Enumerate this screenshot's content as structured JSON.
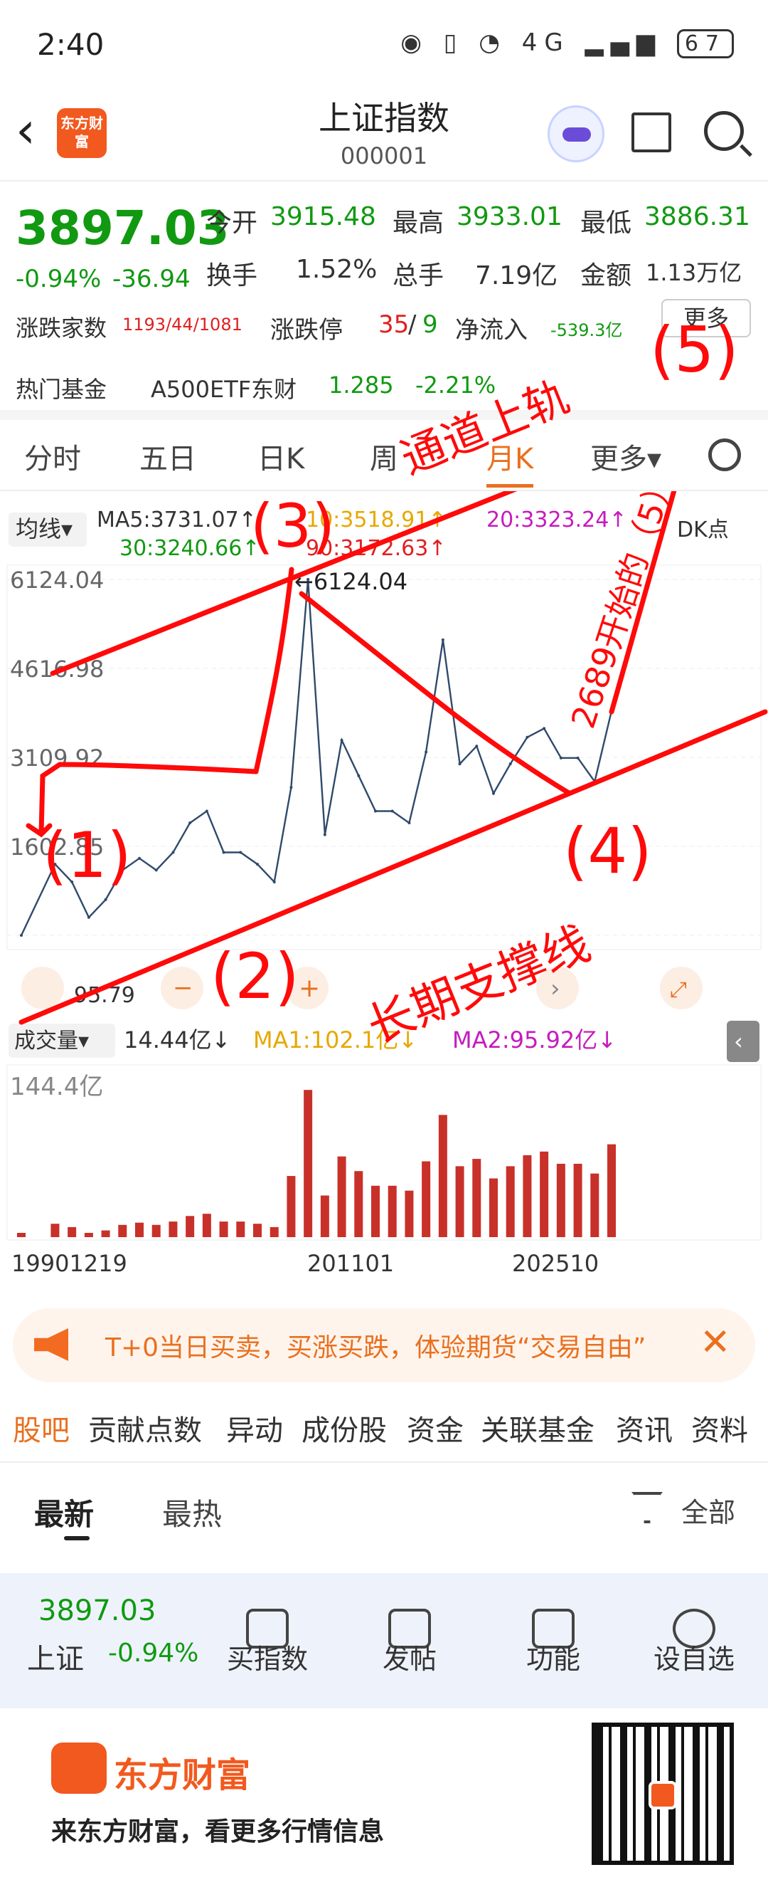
{
  "status_bar": {
    "time": "2:40",
    "network": "4G",
    "battery": "67"
  },
  "header": {
    "brand_logo_text": "东方财富",
    "title": "上证指数",
    "code": "000001"
  },
  "quote": {
    "price": "3897.03",
    "pct": "-0.94%",
    "change": "-36.94",
    "open_label": "今开",
    "open": "3915.48",
    "high_label": "最高",
    "high": "3933.01",
    "low_label": "最低",
    "low": "3886.31",
    "turnover_label": "换手",
    "turnover": "1.52%",
    "volume_label": "总手",
    "volume": "7.19亿",
    "amount_label": "金额",
    "amount": "1.13万亿",
    "breadth_label": "涨跌家数",
    "breadth": "1193/44/1081",
    "limit_label": "涨跌停",
    "limit_up": "35",
    "limit_sep": "/",
    "limit_down": "9",
    "inflow_label": "净流入",
    "inflow": "-539.3亿",
    "more": "更多",
    "fund_label": "热门基金",
    "fund_name": "A500ETF东财",
    "fund_price": "1.285",
    "fund_pct": "-2.21%"
  },
  "tabs": [
    "分时",
    "五日",
    "日K",
    "周",
    "月K",
    "更多▾"
  ],
  "ma": {
    "avg_label": "均线▾",
    "ma5": "MA5:3731.07↑",
    "ma10": "10:3518.91↑",
    "ma20": "20:3323.24↑",
    "ma30": "30:3240.66↑",
    "ma90": "90:3172.63↑",
    "dk": "DK点"
  },
  "chart_data": {
    "type": "line",
    "title": "",
    "y_ticks": [
      "6124.04",
      "4616.98",
      "3109.92",
      "1602.85",
      "95.79"
    ],
    "ylim": [
      95.79,
      6124.04
    ],
    "peak_label": "←6124.04",
    "low_label": "95.79",
    "x_ticks": [
      "19901219",
      "201101",
      "202510"
    ],
    "price_series": [
      [
        1990,
        96
      ],
      [
        1992,
        1300
      ],
      [
        1993,
        1000
      ],
      [
        1994,
        400
      ],
      [
        1995,
        700
      ],
      [
        1996,
        1200
      ],
      [
        1997,
        1400
      ],
      [
        1998,
        1200
      ],
      [
        1999,
        1500
      ],
      [
        2000,
        2000
      ],
      [
        2001,
        2200
      ],
      [
        2002,
        1500
      ],
      [
        2003,
        1500
      ],
      [
        2004,
        1300
      ],
      [
        2005,
        1000
      ],
      [
        2006,
        2600
      ],
      [
        2007,
        6124
      ],
      [
        2008,
        1800
      ],
      [
        2009,
        3400
      ],
      [
        2010,
        2800
      ],
      [
        2011,
        2200
      ],
      [
        2012,
        2200
      ],
      [
        2013,
        2000
      ],
      [
        2014,
        3200
      ],
      [
        2015,
        5100
      ],
      [
        2016,
        3000
      ],
      [
        2017,
        3300
      ],
      [
        2018,
        2500
      ],
      [
        2019,
        3000
      ],
      [
        2020,
        3450
      ],
      [
        2021,
        3600
      ],
      [
        2022,
        3100
      ],
      [
        2023,
        3100
      ],
      [
        2024,
        2700
      ],
      [
        2025,
        3897
      ]
    ],
    "volume_label": "成交量▾",
    "volume_value": "14.44亿↓",
    "vol_ma1": "MA1:102.1亿↓",
    "vol_ma2": "MA2:95.92亿↓",
    "volume_max": "144.4亿"
  },
  "annotations": {
    "top_channel": "通道上轨",
    "support": "长期支撑线",
    "p1": "(1)",
    "p2": "(2)",
    "p3": "(3)",
    "p4": "(4)",
    "p5": "(5)",
    "start_note": "2689开始的（5）"
  },
  "banner": {
    "text": "T+0当日买卖，买涨买跌，体验期货“交易自由”"
  },
  "subtabs": [
    "股吧",
    "贡献点数",
    "异动",
    "成份股",
    "资金",
    "关联基金",
    "资讯",
    "资料"
  ],
  "sort": {
    "latest": "最新",
    "hot": "最热",
    "all": "全部"
  },
  "toolbar": {
    "price": "3897.03",
    "name": "上证",
    "pct": "-0.94%",
    "buy": "买指数",
    "post": "发帖",
    "func": "功能",
    "watch": "设自选"
  },
  "footer": {
    "brand": "东方财富",
    "slogan": "来东方财富，看更多行情信息"
  }
}
